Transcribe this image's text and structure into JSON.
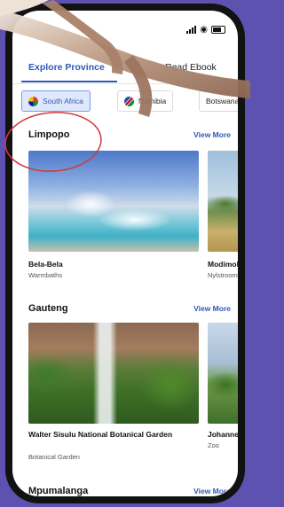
{
  "tabs": {
    "active": "Explore Province",
    "second": "Read Ebook"
  },
  "chips": [
    {
      "label": "South Africa",
      "flag": "south-africa-flag",
      "selected": true
    },
    {
      "label": "Namibia",
      "flag": "namibia-flag",
      "selected": false
    },
    {
      "label": "Botswana",
      "flag": "botswana-flag",
      "selected": false
    }
  ],
  "sections": [
    {
      "title": "Limpopo",
      "view_more": "View More",
      "cards": [
        {
          "title": "Bela-Bela",
          "subtitle": "Warmbaths"
        },
        {
          "title": "Modimol",
          "subtitle": "Nylstroom"
        }
      ]
    },
    {
      "title": "Gauteng",
      "view_more": "View More",
      "cards": [
        {
          "title": "Walter Sisulu National Botanical Garden",
          "subtitle": "Botanical Garden"
        },
        {
          "title": "Johannes",
          "subtitle": "Zoo"
        }
      ]
    },
    {
      "title": "Mpumalanga",
      "view_more": "View More",
      "cards": []
    }
  ],
  "colors": {
    "accent": "#2f58b8",
    "background": "#5e52b0",
    "annotation": "#d23a3a"
  }
}
